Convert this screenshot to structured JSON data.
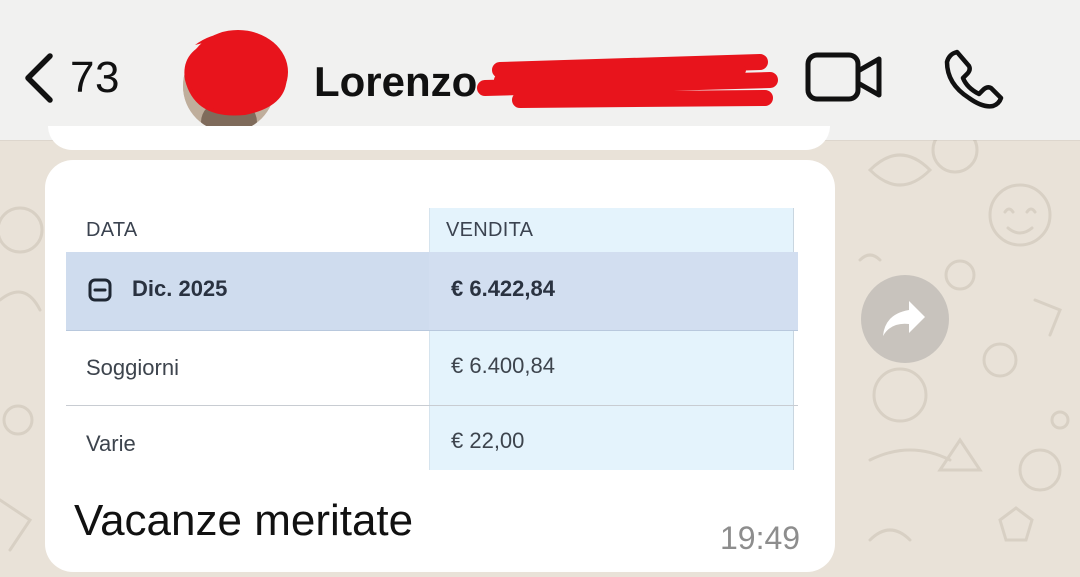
{
  "header": {
    "back_count": "73",
    "contact_name": "Lorenzo"
  },
  "message": {
    "table": {
      "columns": [
        "DATA",
        "VENDITA"
      ],
      "group_row": {
        "label": "Dic. 2025",
        "value": "€ 6.422,84"
      },
      "rows": [
        {
          "label": "Soggiorni",
          "value": "€ 6.400,84"
        },
        {
          "label": "Varie",
          "value": "€ 22,00"
        }
      ]
    },
    "caption": "Vacanze meritate",
    "time": "19:49"
  },
  "colors": {
    "header_bg": "#f1f1f0",
    "wallpaper": "#e9e2d8",
    "bubble": "#ffffff",
    "highlight_row": "#cfdcee",
    "vendita_column": "#e4f3fc",
    "redaction": "#e8141c"
  },
  "icons": [
    "chevron-left-icon",
    "video-camera-icon",
    "phone-icon",
    "minus-square-icon",
    "forward-arrow-icon"
  ]
}
